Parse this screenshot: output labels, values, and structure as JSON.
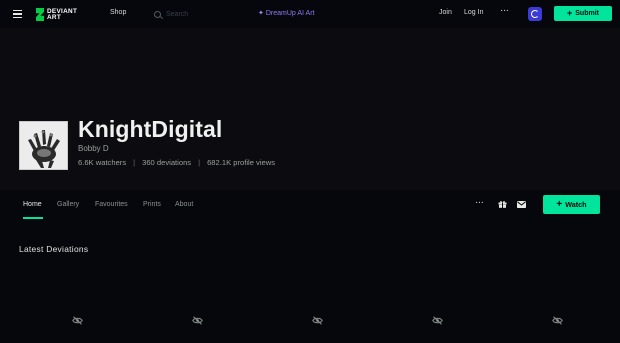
{
  "topbar": {
    "logo_text_line1": "DEVIANT",
    "logo_text_line2": "ART",
    "shop_label": "Shop",
    "search_placeholder": "Search",
    "dreamup_label": "DreamUp AI Art",
    "join_label": "Join",
    "login_label": "Log In",
    "more_label": "···",
    "submit_label": "Submit"
  },
  "profile": {
    "username": "KnightDigital",
    "real_name": "Bobby D",
    "watchers": "6.6K watchers",
    "deviations": "360 deviations",
    "profile_views": "682.1K profile views",
    "separator": "|"
  },
  "tabs": {
    "items": [
      {
        "label": "Home",
        "active": true
      },
      {
        "label": "Gallery",
        "active": false
      },
      {
        "label": "Favourites",
        "active": false
      },
      {
        "label": "Prints",
        "active": false
      },
      {
        "label": "About",
        "active": false
      }
    ],
    "more_label": "···",
    "watch_label": "Watch"
  },
  "content": {
    "section_title": "Latest Deviations",
    "thumbnails": [
      {
        "icon": "eye-slash-icon"
      },
      {
        "icon": "eye-slash-icon"
      },
      {
        "icon": "eye-slash-icon"
      },
      {
        "icon": "eye-slash-icon"
      },
      {
        "icon": "eye-slash-icon"
      }
    ]
  },
  "colors": {
    "accent": "#00e59b",
    "background": "#06070d",
    "dreamup": "#8e7cf0",
    "core_badge": "#3b3bd6"
  }
}
